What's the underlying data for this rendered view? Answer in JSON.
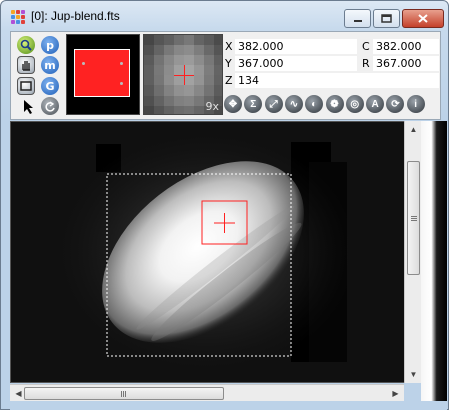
{
  "window": {
    "title": "[0]: Jup-blend.fts",
    "app_icon_colors": [
      "#f5a623",
      "#e0413a",
      "#b24fd6",
      "#4a90e2",
      "#f5a623",
      "#e0413a",
      "#b24fd6",
      "#4a90e2",
      "#e0413a"
    ]
  },
  "tools": {
    "left_column": [
      "magnify-icon",
      "hand-pan-icon",
      "roi-rectangle-icon",
      "pointer-arrow-icon"
    ],
    "right_column_labels": [
      "p",
      "m",
      "G"
    ],
    "reset_icon": "rotate-back-icon"
  },
  "zoom": {
    "label": "9x"
  },
  "readout": {
    "x_label": "X",
    "x_value": "382.000",
    "y_label": "Y",
    "y_value": "367.000",
    "z_label": "Z",
    "z_value": "134",
    "c_label": "C",
    "c_value": "382.000",
    "r_label": "R",
    "r_value": "367.000"
  },
  "function_buttons": [
    {
      "name": "move-arrows-icon",
      "glyph": "✥"
    },
    {
      "name": "sigma-icon",
      "glyph": "Σ"
    },
    {
      "name": "line-measure-icon",
      "glyph": "⤢"
    },
    {
      "name": "waveform-icon",
      "glyph": "∿"
    },
    {
      "name": "contrast-icon",
      "glyph": "◐"
    },
    {
      "name": "color-palette-icon",
      "glyph": "❁"
    },
    {
      "name": "target-icon",
      "glyph": "◎"
    },
    {
      "name": "annotate-text-icon",
      "glyph": "A"
    },
    {
      "name": "refresh-icon",
      "glyph": "⟳"
    },
    {
      "name": "info-icon",
      "glyph": "i"
    }
  ],
  "colors": {
    "roi_box": "#ff2020",
    "selection_border": "#ffffff",
    "pan_region": "#ff2222"
  }
}
